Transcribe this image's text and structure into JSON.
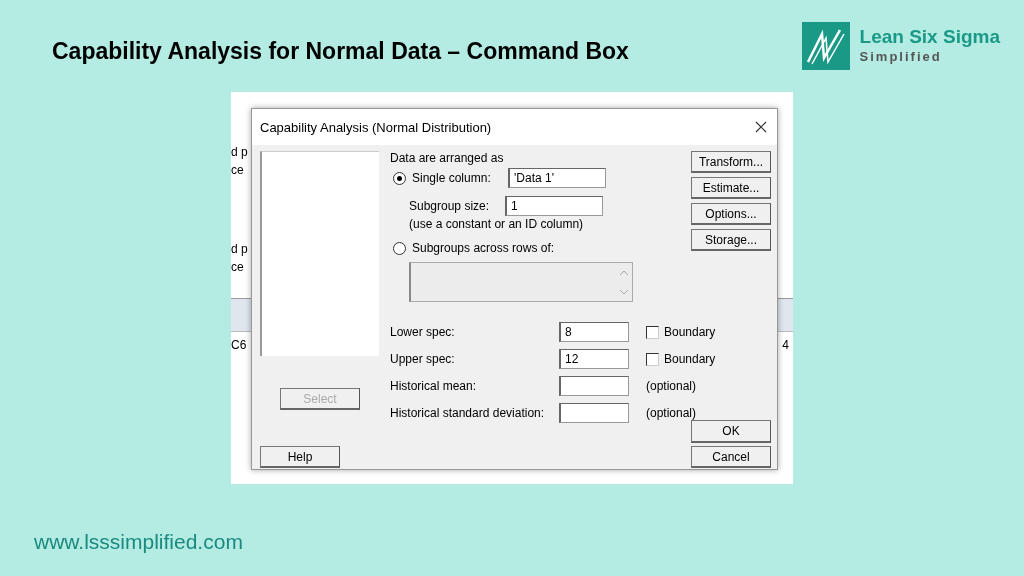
{
  "slide_title": "Capability Analysis for Normal Data – Command Box",
  "logo": {
    "name": "Lean Six Sigma",
    "tagline": "Simplified"
  },
  "background_sheet": {
    "left_fragments": [
      "d p",
      "ce",
      "d p",
      "ce",
      "C6"
    ],
    "right_fragments": [
      "4"
    ]
  },
  "dialog": {
    "title": "Capability Analysis (Normal Distribution)",
    "select_button": {
      "label": "Select",
      "disabled": true
    },
    "help_button": "Help",
    "data_arrangement": {
      "label": "Data are arranged as",
      "single_column": {
        "label": "Single column:",
        "selected": true,
        "value": "'Data 1'"
      },
      "subgroup_size": {
        "label": "Subgroup size:",
        "value": "1"
      },
      "hint": "(use a constant or an ID column)",
      "across_rows": {
        "label": "Subgroups across rows of:",
        "selected": false
      }
    },
    "side_buttons": [
      "Transform...",
      "Estimate...",
      "Options...",
      "Storage..."
    ],
    "specs": [
      {
        "label": "Lower spec:",
        "value": "8",
        "kind": "boundary",
        "suffix": "Boundary",
        "checked": false
      },
      {
        "label": "Upper spec:",
        "value": "12",
        "kind": "boundary",
        "suffix": "Boundary",
        "checked": false
      },
      {
        "label": "Historical mean:",
        "kind": "optional",
        "suffix": "(optional)"
      },
      {
        "label": "Historical standard deviation:",
        "kind": "optional",
        "suffix": "(optional)"
      }
    ],
    "ok_button": "OK",
    "cancel_button": "Cancel"
  },
  "website": "www.lsssimplified.com"
}
